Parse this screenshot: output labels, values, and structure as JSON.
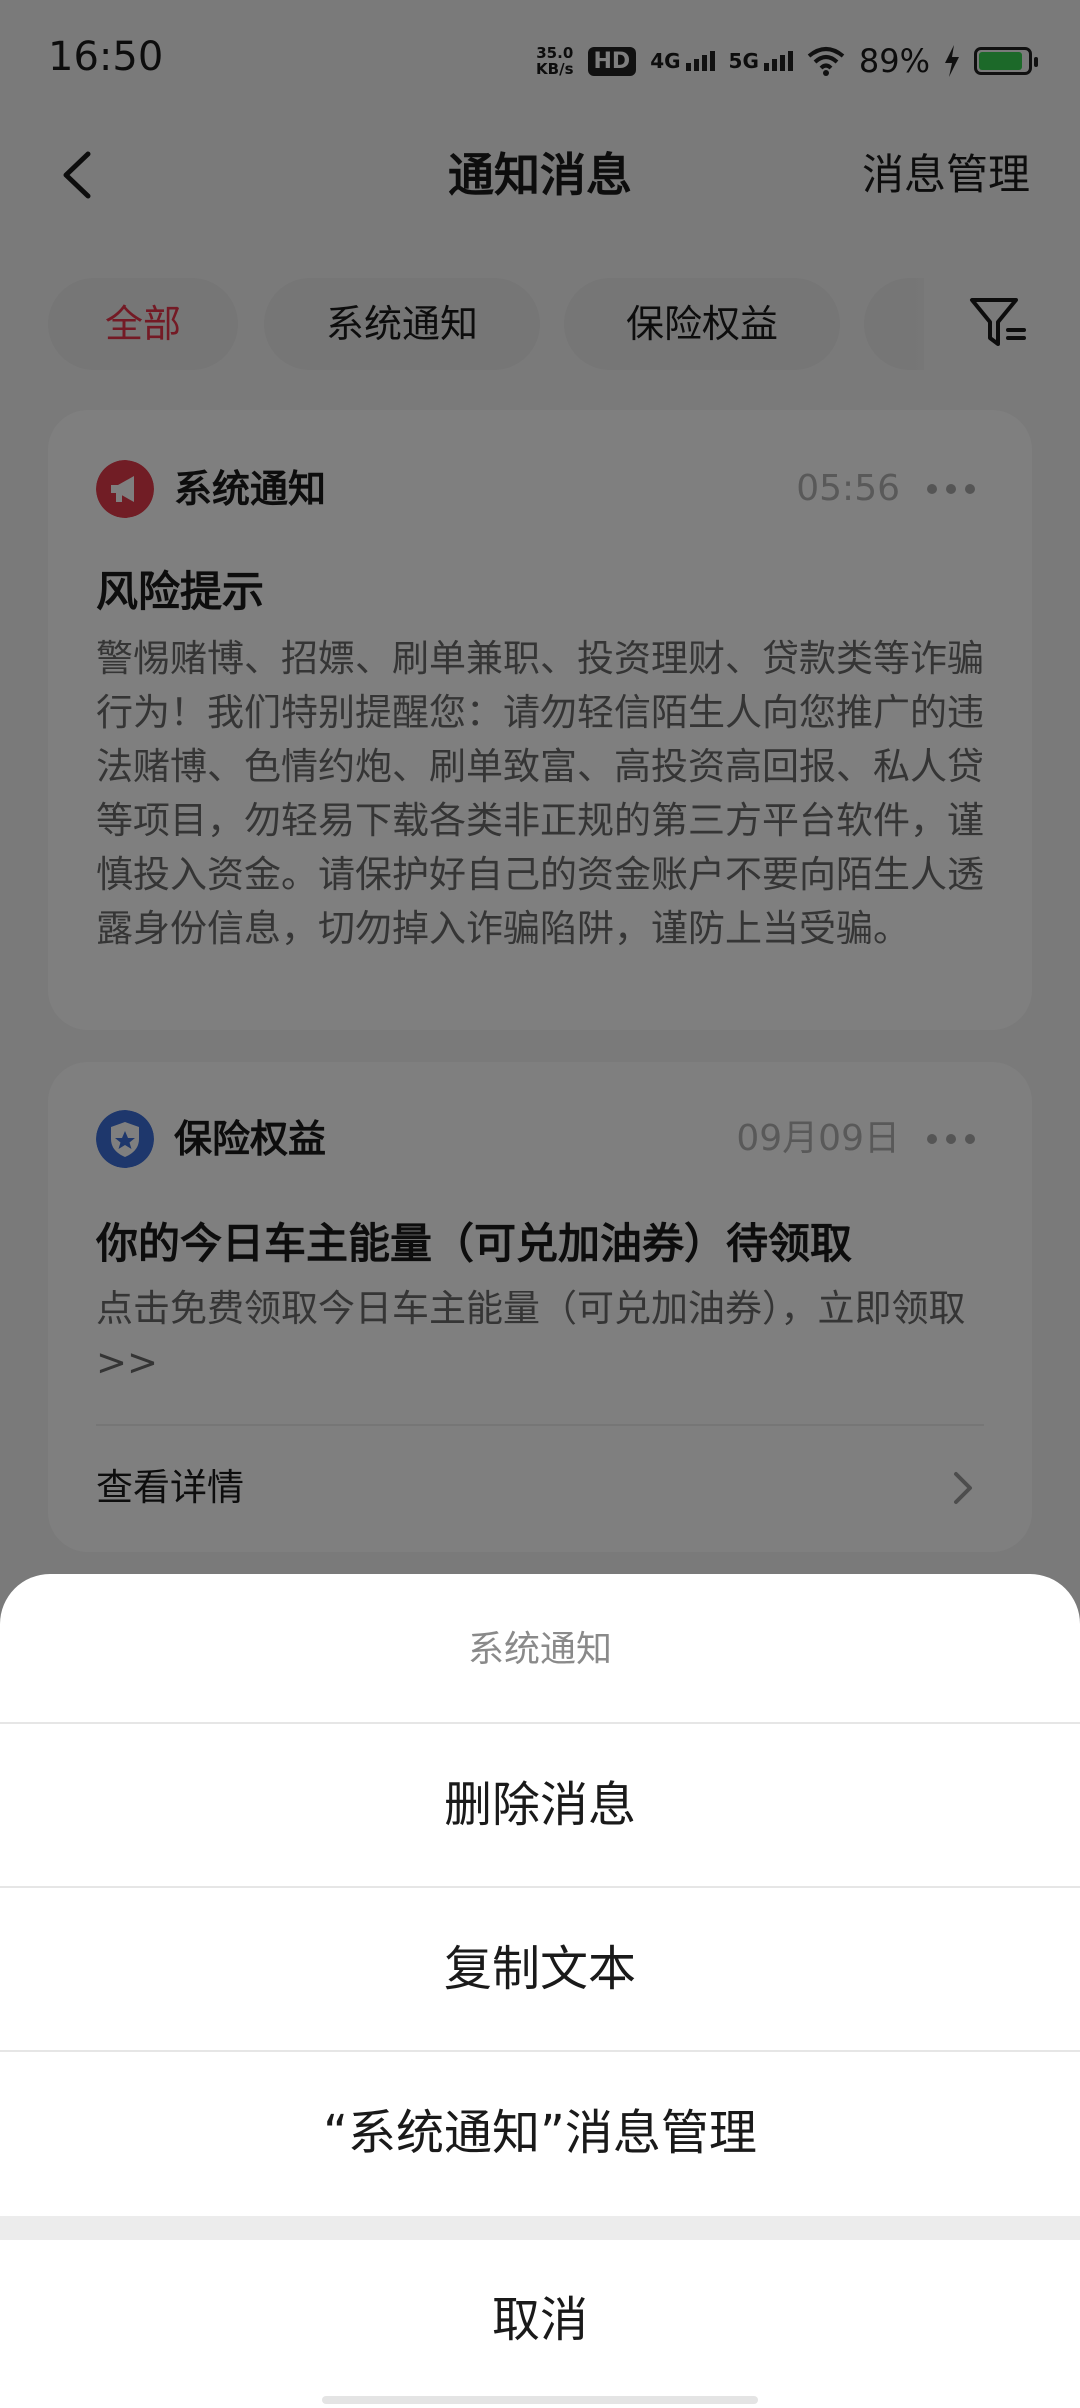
{
  "status_bar": {
    "time": "16:50",
    "net_speed_value": "35.0",
    "net_speed_unit": "KB/s",
    "hd_label": "HD",
    "net_4g": "4G",
    "net_5g": "5G",
    "battery_percent": "89%",
    "battery_level": 0.89
  },
  "header": {
    "title": "通知消息",
    "manage_label": "消息管理"
  },
  "tabs": [
    {
      "label": "全部",
      "active": true
    },
    {
      "label": "系统通知",
      "active": false
    },
    {
      "label": "保险权益",
      "active": false
    }
  ],
  "cards": [
    {
      "source": "系统通知",
      "time": "05:56",
      "title": "风险提示",
      "body": "警惕赌博、招嫖、刷单兼职、投资理财、贷款类等诈骗行为！我们特别提醒您：请勿轻信陌生人向您推广的违法赌博、色情约炮、刷单致富、高投资高回报、私人贷等项目，勿轻易下载各类非正规的第三方平台软件，谨慎投入资金。请保护好自己的资金账户不要向陌生人透露身份信息，切勿掉入诈骗陷阱，谨防上当受骗。",
      "icon_color": "#e23b4a"
    },
    {
      "source": "保险权益",
      "time": "09月09日",
      "title": "你的今日车主能量（可兑加油券）待领取",
      "body": "点击免费领取今日车主能量（可兑加油券），立即领取>>",
      "detail_label": "查看详情",
      "icon_color": "#3d6fd8"
    }
  ],
  "action_sheet": {
    "title": "系统通知",
    "items": [
      "删除消息",
      "复制文本",
      "“系统通知”消息管理"
    ],
    "cancel_label": "取消"
  },
  "colors": {
    "accent": "#e8354a",
    "overlay": "rgba(0,0,0,0.5)"
  }
}
